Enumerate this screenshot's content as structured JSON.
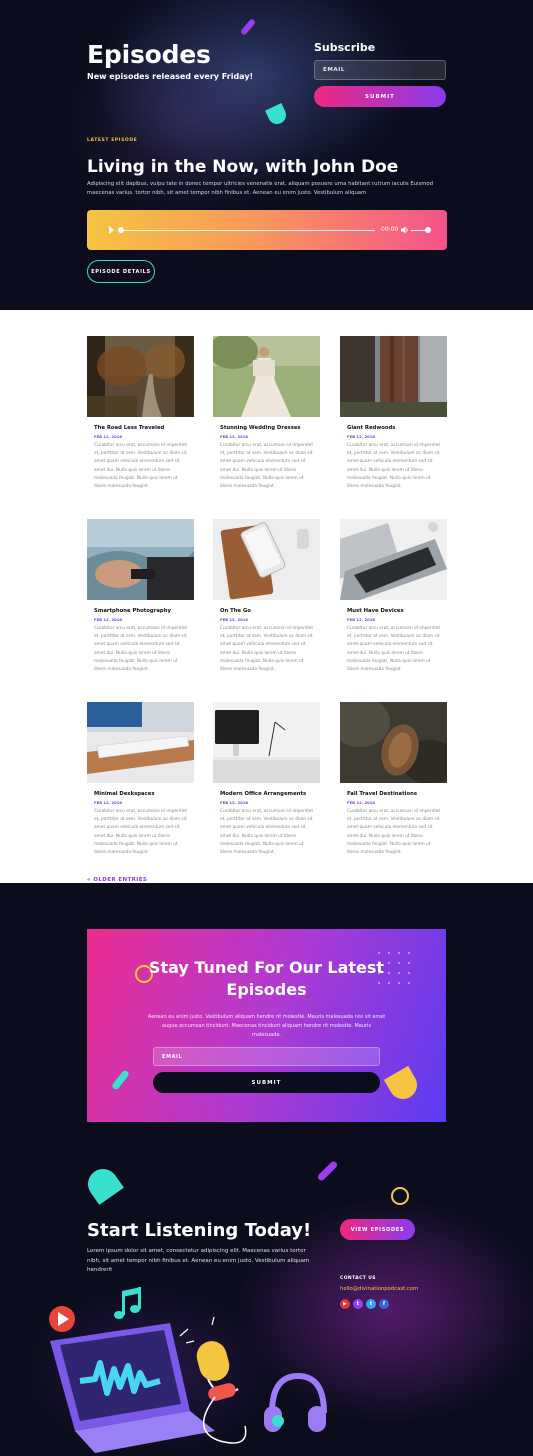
{
  "hero": {
    "title": "Episodes",
    "subtitle": "New episodes released every Friday!",
    "subscribe": {
      "title": "Subscribe",
      "email_placeholder": "EMAIL",
      "submit_label": "SUBMIT"
    },
    "latest_label": "LATEST EPISODE",
    "episode_title": "Living in the Now, with John Doe",
    "episode_desc": "Adipiscing elit dapibus, vulpu tate in donec tempor ultricies venenatis erat, aliquam posuere urna habitant rutrum iaculis Euismod maecenas varius. tortor nibh, sit amet tempor nibh finibus et. Aenean eu enim justo. Vestibulum aliquam",
    "player": {
      "time": "00:00",
      "progress": 0
    },
    "details_label": "EPISODE DETAILS"
  },
  "posts": {
    "items": [
      {
        "title": "The Road Less Traveled",
        "date": "FEB 12, 2018",
        "excerpt": "Curabitur arcu erat, accumsan id imperdiet et, porttitor at sem. Vestibulum ac diam sit amet quam vehicula elementum sed sit amet dui. Nulla quis lorem ut libero malesuada feugiat. Nulla quis lorem ut libero malesuada feugiat."
      },
      {
        "title": "Stunning Wedding Dresses",
        "date": "FEB 12, 2018",
        "excerpt": "Curabitur arcu erat, accumsan id imperdiet et, porttitor at sem. Vestibulum ac diam sit amet quam vehicula elementum sed sit amet dui. Nulla quis lorem ut libero malesuada feugiat. Nulla quis lorem ut libero malesuada feugiat."
      },
      {
        "title": "Giant Redwoods",
        "date": "FEB 12, 2018",
        "excerpt": "Curabitur arcu erat, accumsan id imperdiet et, porttitor at sem. Vestibulum ac diam sit amet quam vehicula elementum sed sit amet dui. Nulla quis lorem ut libero malesuada feugiat. Nulla quis lorem ut libero malesuada feugiat."
      },
      {
        "title": "Smartphone Photography",
        "date": "FEB 12, 2018",
        "excerpt": "Curabitur arcu erat, accumsan id imperdiet et, porttitor at sem. Vestibulum ac diam sit amet quam vehicula elementum sed sit amet dui. Nulla quis lorem ut libero malesuada feugiat. Nulla quis lorem ut libero malesuada feugiat."
      },
      {
        "title": "On The Go",
        "date": "FEB 12, 2018",
        "excerpt": "Curabitur arcu erat, accumsan id imperdiet et, porttitor at sem. Vestibulum ac diam sit amet quam vehicula elementum sed sit amet dui. Nulla quis lorem ut libero malesuada feugiat. Nulla quis lorem ut libero malesuada feugiat."
      },
      {
        "title": "Must Have Devices",
        "date": "FEB 12, 2018",
        "excerpt": "Curabitur arcu erat, accumsan id imperdiet et, porttitor at sem. Vestibulum ac diam sit amet quam vehicula elementum sed sit amet dui. Nulla quis lorem ut libero malesuada feugiat. Nulla quis lorem ut libero malesuada feugiat."
      },
      {
        "title": "Minimal Deskspaces",
        "date": "FEB 12, 2018",
        "excerpt": "Curabitur arcu erat, accumsan id imperdiet et, porttitor at sem. Vestibulum ac diam sit amet quam vehicula elementum sed sit amet dui. Nulla quis lorem ut libero malesuada feugiat. Nulla quis lorem ut libero malesuada feugiat."
      },
      {
        "title": "Modern Office Arrangements",
        "date": "FEB 12, 2018",
        "excerpt": "Curabitur arcu erat, accumsan id imperdiet et, porttitor at sem. Vestibulum ac diam sit amet quam vehicula elementum sed sit amet dui. Nulla quis lorem ut libero malesuada feugiat. Nulla quis lorem ut libero malesuada feugiat."
      },
      {
        "title": "Fall Travel Destinations",
        "date": "FEB 12, 2018",
        "excerpt": "Curabitur arcu erat, accumsan id imperdiet et, porttitor at sem. Vestibulum ac diam sit amet quam vehicula elementum sed sit amet dui. Nulla quis lorem ut libero malesuada feugiat. Nulla quis lorem ut libero malesuada feugiat."
      }
    ],
    "older_label": "« OLDER ENTRIES"
  },
  "newsletter": {
    "title": "Stay Tuned For Our Latest Episodes",
    "desc": "Aenean eu enim justo. Vestibulum aliquam hendre rit molestie. Mauris malesuada nisi sit amet augue accumsan tincidunt. Maecenas tincidunt aliquam hendre rit molestie. Mauris malesuada.",
    "email_placeholder": "EMAIL",
    "submit_label": "SUBMIT"
  },
  "footer": {
    "title": "Start Listening Today!",
    "desc": "Lorem ipsum dolor sit amet, consectetur adipiscing elit. Maecenas varius tortor nibh, sit amet tempor nibh finibus et. Aenean eu enim justo. Vestibulum aliquam hendrerit",
    "view_label": "VIEW EPISODES",
    "contact_label": "CONTACT US",
    "email": "hello@divinationpodcast.com",
    "socials": [
      {
        "icon": "youtube-icon",
        "glyph": "▶",
        "color": "#e8312f"
      },
      {
        "icon": "twitch-icon",
        "glyph": "t",
        "color": "#8e44ef"
      },
      {
        "icon": "twitter-icon",
        "glyph": "t",
        "color": "#2fa4f0"
      },
      {
        "icon": "facebook-icon",
        "glyph": "f",
        "color": "#3b63d9"
      }
    ]
  },
  "colors": {
    "dark_bg": "#0b0d1c",
    "accent_pink": "#f0287f",
    "accent_purple": "#8a3bef",
    "accent_yellow": "#f5c440",
    "accent_cyan": "#37e0cf"
  }
}
